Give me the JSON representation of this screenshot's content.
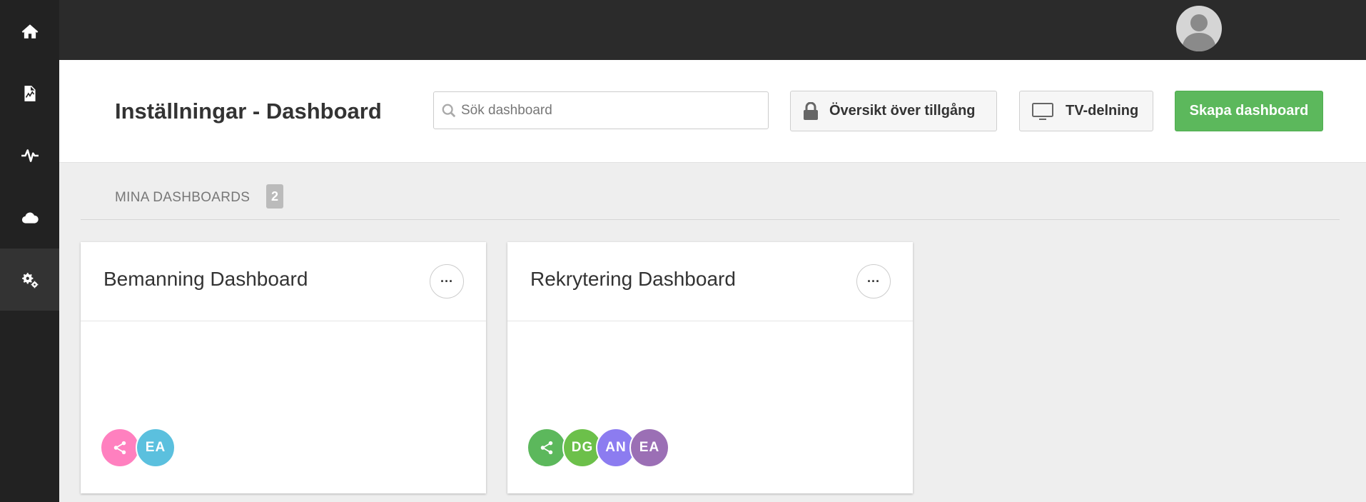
{
  "sidebar": {
    "items": [
      {
        "icon": "home-icon",
        "active": false
      },
      {
        "icon": "report-icon",
        "active": false
      },
      {
        "icon": "pulse-icon",
        "active": false
      },
      {
        "icon": "cloud-icon",
        "active": false
      },
      {
        "icon": "settings-gears-icon",
        "active": true
      }
    ]
  },
  "topbar": {
    "avatar_icon": "user-avatar-icon",
    "menu_icon": "chevron-down-icon"
  },
  "header": {
    "title_bold": "Inställningar",
    "title_rest": " - Dashboard",
    "search_placeholder": "Sök dashboard",
    "access_button": "Översikt över tillgång",
    "tv_button": "TV-delning",
    "create_button": "Skapa dashboard"
  },
  "section": {
    "label": "MINA DASHBOARDS",
    "count": "2"
  },
  "cards": [
    {
      "title": "Bemanning Dashboard",
      "more_label": "···",
      "chips": [
        {
          "type": "share",
          "icon": "share-icon",
          "color": "#ff80bf"
        },
        {
          "type": "user",
          "initials": "EA",
          "color": "#5bc0de"
        }
      ]
    },
    {
      "title": "Rekrytering Dashboard",
      "more_label": "···",
      "chips": [
        {
          "type": "share",
          "icon": "share-icon",
          "color": "#5cb85c"
        },
        {
          "type": "user",
          "initials": "DG",
          "color": "#6cc04a"
        },
        {
          "type": "user",
          "initials": "AN",
          "color": "#8c7cf0"
        },
        {
          "type": "user",
          "initials": "EA",
          "color": "#9b6fb5"
        }
      ]
    }
  ],
  "colors": {
    "accent_green": "#5cb85c",
    "sidebar_bg": "#222222",
    "topbar_bg": "#2b2b2b"
  }
}
